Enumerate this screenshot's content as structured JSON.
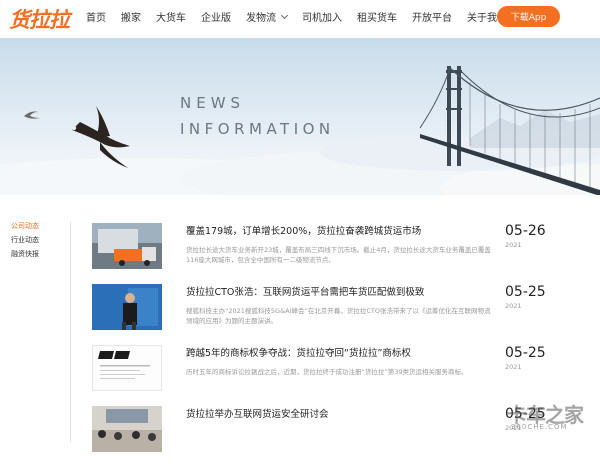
{
  "header": {
    "logo": "货拉拉",
    "nav": [
      {
        "label": "首页",
        "dropdown": false
      },
      {
        "label": "搬家",
        "dropdown": false
      },
      {
        "label": "大货车",
        "dropdown": false
      },
      {
        "label": "企业版",
        "dropdown": false
      },
      {
        "label": "发物流",
        "dropdown": true
      },
      {
        "label": "司机加入",
        "dropdown": false
      },
      {
        "label": "租买货车",
        "dropdown": false
      },
      {
        "label": "开放平台",
        "dropdown": false
      },
      {
        "label": "关于我们",
        "dropdown": true
      }
    ],
    "download_label": "下载App"
  },
  "banner": {
    "line1": "NEWS",
    "line2": "INFORMATION"
  },
  "sidebar": {
    "items": [
      {
        "label": "公司动态",
        "active": true
      },
      {
        "label": "行业动态",
        "active": false
      },
      {
        "label": "融资快报",
        "active": false
      }
    ]
  },
  "news": [
    {
      "title": "覆盖179城，订单增长200%，货拉拉奋袭跨城货运市场",
      "desc": "货拉拉长途大货车业务新开23城，覆盖布局三四线下沉市场。截止4月，货拉拉长途大货车业务覆盖已覆盖116座大网城市，包含全中国所有一二级物流节点。",
      "date": "05-26",
      "year": "2021",
      "thumb": "truck"
    },
    {
      "title": "货拉拉CTO张浩：互联网货运平台需把车货匹配做到极致",
      "desc": "搜狐科技主办“2021搜狐科技5G&AI峰会”在北京开幕，货拉拉CTO张浩带来了以《运筹优化在互联网物流领域的应用》为题的主题演讲。",
      "date": "05-25",
      "year": "2021",
      "thumb": "speaker"
    },
    {
      "title": "跨越5年的商标权争夺战：货拉拉夺回“货拉拉”商标权",
      "desc": "历时五年的商标诉讼拉锯战之后，近期，货拉拉终于成功注册“货拉拉”第39类货运相关服务商标。",
      "date": "05-25",
      "year": "2021",
      "thumb": "document"
    },
    {
      "title": "货拉拉举办互联网货运安全研讨会",
      "desc": "",
      "date": "05-25",
      "year": "2021",
      "thumb": "meeting"
    }
  ],
  "watermark": {
    "text": "卡车之家",
    "sub": "360CHE.COM"
  }
}
